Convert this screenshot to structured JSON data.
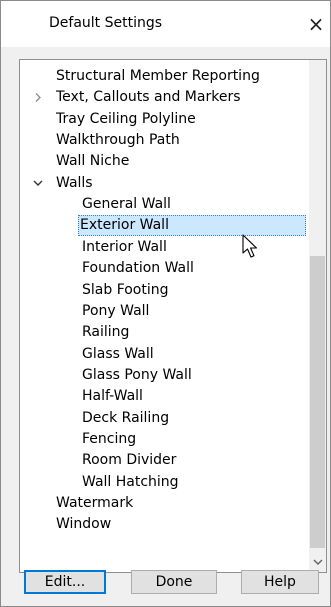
{
  "dialog": {
    "title": "Default Settings",
    "close_glyph": "×"
  },
  "tree": {
    "items": [
      {
        "label": "Structural Member Reporting",
        "level": 0,
        "expander": ""
      },
      {
        "label": "Text, Callouts and Markers",
        "level": 0,
        "expander": "collapsed"
      },
      {
        "label": "Tray Ceiling Polyline",
        "level": 0,
        "expander": ""
      },
      {
        "label": "Walkthrough Path",
        "level": 0,
        "expander": ""
      },
      {
        "label": "Wall Niche",
        "level": 0,
        "expander": ""
      },
      {
        "label": "Walls",
        "level": 0,
        "expander": "expanded"
      },
      {
        "label": "General Wall",
        "level": 1,
        "expander": ""
      },
      {
        "label": "Exterior Wall",
        "level": 1,
        "expander": "",
        "selected": true
      },
      {
        "label": "Interior Wall",
        "level": 1,
        "expander": ""
      },
      {
        "label": "Foundation Wall",
        "level": 1,
        "expander": ""
      },
      {
        "label": "Slab Footing",
        "level": 1,
        "expander": ""
      },
      {
        "label": "Pony Wall",
        "level": 1,
        "expander": ""
      },
      {
        "label": "Railing",
        "level": 1,
        "expander": ""
      },
      {
        "label": "Glass Wall",
        "level": 1,
        "expander": ""
      },
      {
        "label": "Glass Pony Wall",
        "level": 1,
        "expander": ""
      },
      {
        "label": "Half-Wall",
        "level": 1,
        "expander": ""
      },
      {
        "label": "Deck Railing",
        "level": 1,
        "expander": ""
      },
      {
        "label": "Fencing",
        "level": 1,
        "expander": ""
      },
      {
        "label": "Room Divider",
        "level": 1,
        "expander": ""
      },
      {
        "label": "Wall Hatching",
        "level": 1,
        "expander": ""
      },
      {
        "label": "Watermark",
        "level": 0,
        "expander": ""
      },
      {
        "label": "Window",
        "level": 0,
        "expander": ""
      }
    ]
  },
  "buttons": {
    "edit": "Edit...",
    "done": "Done",
    "help": "Help"
  },
  "colors": {
    "selection_bg": "#cce8ff",
    "selection_border": "#3d7fc8",
    "button_default_border": "#0078d7"
  }
}
